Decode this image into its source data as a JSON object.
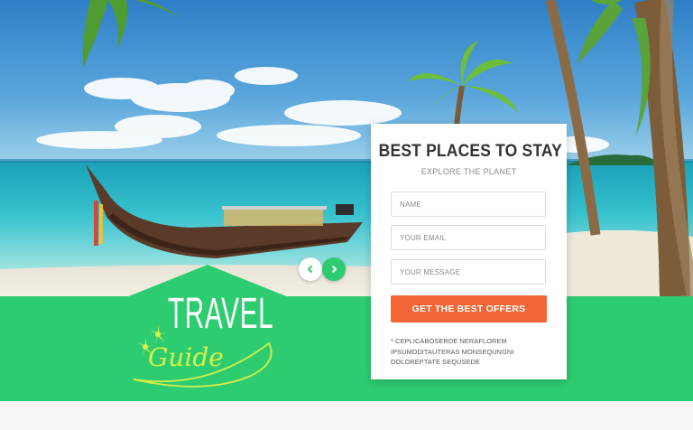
{
  "form": {
    "title": "BEST PLACES TO STAY",
    "subtitle": "EXPLORE THE PLANET",
    "name_placeholder": "NAME",
    "email_placeholder": "YOUR EMAIL",
    "message_placeholder": "YOUR MESSAGE",
    "submit_label": "GET THE BEST OFFERS",
    "note": "* CEPLICABOSERDE NERAFLOREM IPSUMDDITAUTERAS MONSEQUNGNI DOLOREPTATE SEQUSEDE"
  },
  "logo": {
    "word1": "TRAVEL",
    "word2": "Guide"
  },
  "slider": {
    "prev_icon": "chevron-left-icon",
    "next_icon": "chevron-right-icon"
  },
  "colors": {
    "brand_green": "#2ecc71",
    "cta_orange": "#f26534"
  }
}
